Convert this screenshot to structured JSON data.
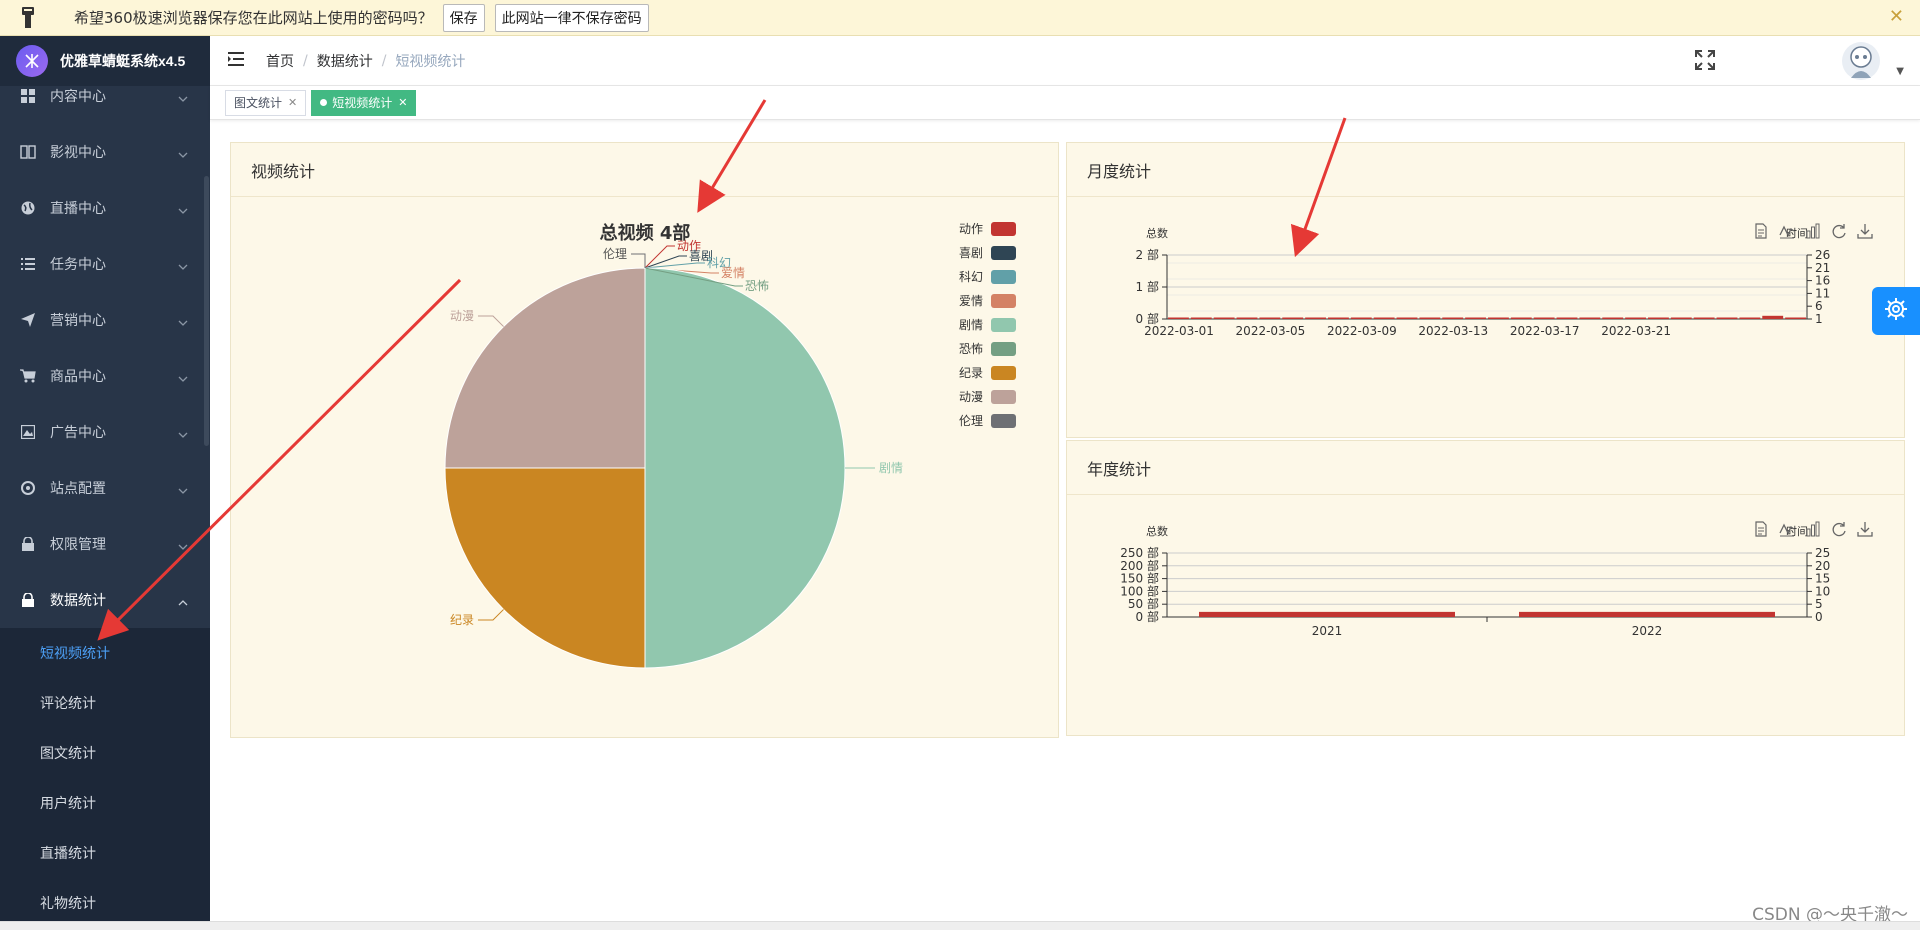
{
  "password_bar": {
    "message": "希望360极速浏览器保存您在此网站上使用的密码吗？",
    "save_label": "保存",
    "never_label": "此网站一律不保存密码",
    "close": "✕"
  },
  "app": {
    "title": "优雅草蜻蜓系统x4.5"
  },
  "sidebar": {
    "items": [
      {
        "label": "内容中心",
        "icon": "grid-icon"
      },
      {
        "label": "影视中心",
        "icon": "book-icon"
      },
      {
        "label": "直播中心",
        "icon": "globe-icon"
      },
      {
        "label": "任务中心",
        "icon": "list-icon"
      },
      {
        "label": "营销中心",
        "icon": "send-icon"
      },
      {
        "label": "商品中心",
        "icon": "cart-icon"
      },
      {
        "label": "广告中心",
        "icon": "image-icon"
      },
      {
        "label": "站点配置",
        "icon": "target-icon"
      },
      {
        "label": "权限管理",
        "icon": "lock-icon"
      },
      {
        "label": "数据统计",
        "icon": "lock-icon"
      }
    ],
    "subitems": [
      "短视频统计",
      "评论统计",
      "图文统计",
      "用户统计",
      "直播统计",
      "礼物统计"
    ]
  },
  "breadcrumb": [
    "首页",
    "数据统计",
    "短视频统计"
  ],
  "tags": [
    {
      "label": "图文统计",
      "active": false
    },
    {
      "label": "短视频统计",
      "active": true
    }
  ],
  "cards": {
    "video": {
      "title": "视频统计"
    },
    "monthly": {
      "title": "月度统计"
    },
    "yearly": {
      "title": "年度统计"
    }
  },
  "watermark": "CSDN @～央千澈～",
  "chart_data": [
    {
      "type": "pie",
      "title": "总视频 4部",
      "categories": [
        "动作",
        "喜剧",
        "科幻",
        "爱情",
        "剧情",
        "恐怖",
        "纪录",
        "动漫",
        "伦理"
      ],
      "values": [
        0,
        0,
        0,
        0,
        2,
        0,
        1,
        1,
        0
      ],
      "colors": [
        "#c23531",
        "#2f4554",
        "#61a0a8",
        "#d48265",
        "#91c7ae",
        "#749f83",
        "#ca8622",
        "#bda29a",
        "#6e7074"
      ],
      "legend_position": "right"
    },
    {
      "type": "bar",
      "ylabel": "总数",
      "y2label": "时间",
      "ylim": [
        0,
        2
      ],
      "y_ticks": [
        "2 部",
        "1 部",
        "0 部"
      ],
      "y2_ticks": [
        "26",
        "21",
        "16",
        "11",
        "6",
        "1"
      ],
      "x_ticks": [
        "2022-03-01",
        "2022-03-05",
        "2022-03-09",
        "2022-03-13",
        "2022-03-17",
        "2022-03-21"
      ],
      "values": [
        0,
        0,
        0,
        0,
        0,
        0,
        0,
        0,
        0,
        0,
        0,
        0,
        0,
        0,
        0,
        0,
        0,
        0,
        0,
        0,
        0,
        0,
        0,
        0,
        0,
        0,
        0.1,
        0
      ],
      "color": "#c23531",
      "grid": true
    },
    {
      "type": "bar",
      "ylabel": "总数",
      "y2label": "时间",
      "ylim": [
        0,
        250
      ],
      "y_ticks": [
        "250 部",
        "200 部",
        "150 部",
        "100 部",
        "50 部",
        "0 部"
      ],
      "y2_ticks": [
        "25",
        "20",
        "15",
        "10",
        "5",
        "0"
      ],
      "categories": [
        "2021",
        "2022"
      ],
      "values": [
        20,
        20
      ],
      "color": "#c23531",
      "grid": true
    }
  ]
}
